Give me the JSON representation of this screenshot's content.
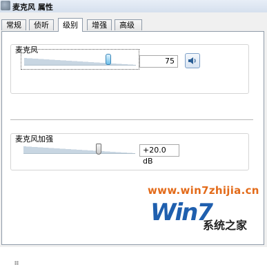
{
  "window": {
    "title": "麦克风 属性"
  },
  "tabs": [
    {
      "label": "常规"
    },
    {
      "label": "侦听"
    },
    {
      "label": "级别",
      "active": true
    },
    {
      "label": "增强"
    },
    {
      "label": "高级"
    }
  ],
  "microphone": {
    "label": "麦克风",
    "value": "75",
    "level": 0.75
  },
  "boost": {
    "label": "麦克风加强",
    "value": "+20.0 dB",
    "level": 0.67
  },
  "watermark": {
    "url": "www.win7zhijia.cn",
    "logo_text": "Win7",
    "brand": "系统之家"
  },
  "colors": {
    "accent": "#1f5fae",
    "watermark": "#e36b1a"
  }
}
